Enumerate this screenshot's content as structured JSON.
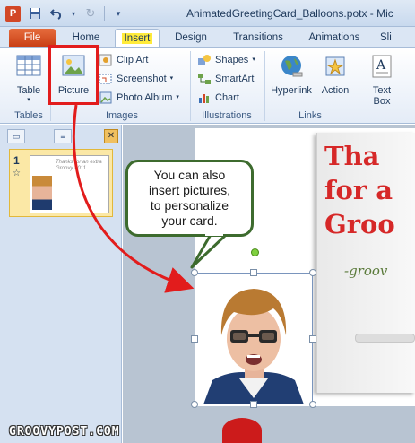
{
  "window": {
    "app_icon": "P",
    "title": "AnimatedGreetingCard_Balloons.potx - Mic"
  },
  "quick_access": [
    {
      "icon": "save-icon"
    },
    {
      "icon": "undo-icon"
    },
    {
      "icon": "redo-icon"
    },
    {
      "icon": "customize-qat-icon"
    }
  ],
  "tabs": {
    "file": "File",
    "home": "Home",
    "insert": "Insert",
    "design": "Design",
    "transitions": "Transitions",
    "animations": "Animations",
    "slideshow": "Sli"
  },
  "ribbon": {
    "tables": {
      "table": "Table",
      "label": "Tables"
    },
    "images": {
      "picture": "Picture",
      "clip_art": "Clip Art",
      "screenshot": "Screenshot",
      "photo_album": "Photo Album",
      "label": "Images"
    },
    "illustrations": {
      "shapes": "Shapes",
      "smartart": "SmartArt",
      "chart": "Chart",
      "label": "Illustrations"
    },
    "links": {
      "hyperlink": "Hyperlink",
      "action": "Action",
      "label": "Links"
    },
    "text": {
      "text_box_1": "Text",
      "text_box_2": "Box"
    }
  },
  "slides_pane": {
    "slide_number": "1",
    "thumb_text": "Thanks for an extra Groovy 2011"
  },
  "slide": {
    "card_text_1": "Tha",
    "card_text_2": "for a",
    "card_text_3": "Groo",
    "card_signature": "-groov"
  },
  "callout": {
    "line1": "You can also",
    "line2": "insert pictures,",
    "line3": "to personalize",
    "line4": "your card."
  },
  "watermark": "GROOVYPOST.COM",
  "colors": {
    "highlight": "#e21c1c",
    "arrow": "#e21c1c",
    "callout_border": "#3d6b2e",
    "file_tab": "#d24726",
    "card_text": "#d62828"
  }
}
